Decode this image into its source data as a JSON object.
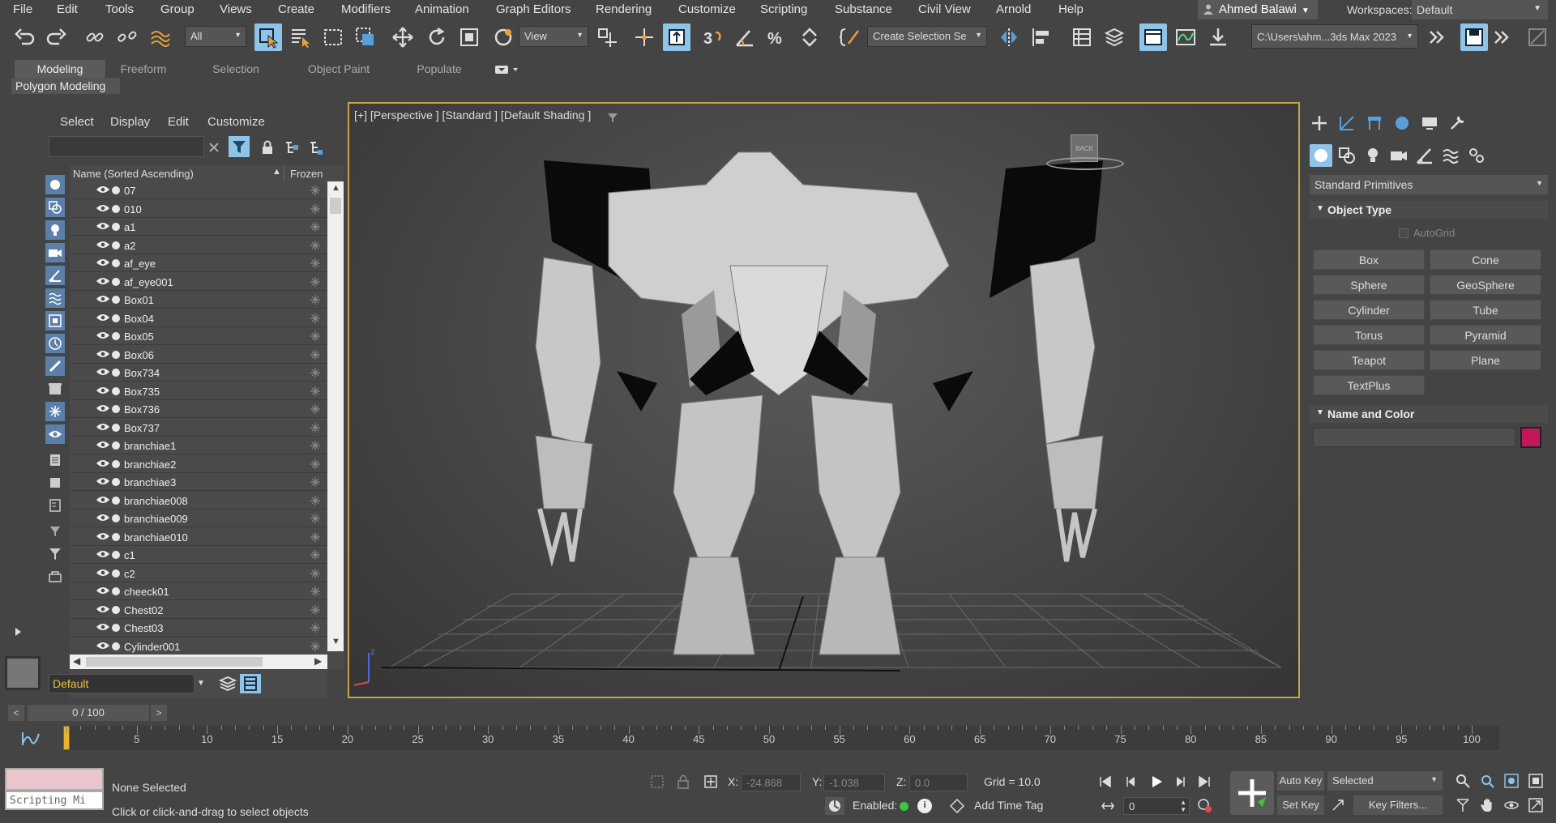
{
  "menubar": {
    "items": [
      "File",
      "Edit",
      "Tools",
      "Group",
      "Views",
      "Create",
      "Modifiers",
      "Animation",
      "Graph Editors",
      "Rendering",
      "Customize",
      "Scripting",
      "Substance",
      "Civil View",
      "Arnold",
      "Help"
    ],
    "user": "Ahmed Balawi",
    "workspaces_label": "Workspaces:",
    "workspace_value": "Default"
  },
  "toolbar": {
    "filter_value": "All",
    "view_value": "View",
    "selection_set_value": "Create Selection Se",
    "project_path": "C:\\Users\\ahm...3ds Max 2023"
  },
  "ribbon": {
    "tabs": [
      "Modeling",
      "Freeform",
      "Selection",
      "Object Paint",
      "Populate"
    ],
    "active_tab": "Modeling",
    "panel_label": "Polygon Modeling"
  },
  "scene_explorer": {
    "menus": [
      "Select",
      "Display",
      "Edit",
      "Customize"
    ],
    "column_name": "Name (Sorted Ascending)",
    "column_frozen": "Frozen",
    "items": [
      "07",
      "010",
      "a1",
      "a2",
      "af_eye",
      "af_eye001",
      "Box01",
      "Box04",
      "Box05",
      "Box06",
      "Box734",
      "Box735",
      "Box736",
      "Box737",
      "branchiae1",
      "branchiae2",
      "branchiae3",
      "branchiae008",
      "branchiae009",
      "branchiae010",
      "c1",
      "c2",
      "cheeck01",
      "Chest02",
      "Chest03",
      "Cylinder001"
    ],
    "layer_value": "Default"
  },
  "viewport": {
    "label": "[+] [Perspective ] [Standard ] [Default Shading ]",
    "viewcube_face": "BACK"
  },
  "command_panel": {
    "category": "Standard Primitives",
    "object_type_title": "Object Type",
    "autogrid_label": "AutoGrid",
    "buttons": [
      "Box",
      "Cone",
      "Sphere",
      "GeoSphere",
      "Cylinder",
      "Tube",
      "Torus",
      "Pyramid",
      "Teapot",
      "Plane",
      "TextPlus"
    ],
    "name_color_title": "Name and Color",
    "object_color": "#c2185b"
  },
  "timeline": {
    "frame_display": "0 / 100",
    "ticks": [
      "5",
      "10",
      "15",
      "20",
      "25",
      "30",
      "35",
      "40",
      "45",
      "50",
      "55",
      "60",
      "65",
      "70",
      "75",
      "80",
      "85",
      "90",
      "95",
      "100"
    ]
  },
  "status": {
    "script_label": "Scripting Mi",
    "selection": "None Selected",
    "prompt": "Click or click-and-drag to select objects",
    "x_label": "X:",
    "x_value": "-24.868",
    "y_label": "Y:",
    "y_value": "-1.038",
    "z_label": "Z:",
    "z_value": "0.0",
    "grid": "Grid = 10.0",
    "enabled_label": "Enabled:",
    "add_time_tag": "Add Time Tag",
    "auto_key": "Auto Key",
    "set_key": "Set Key",
    "key_mode_value": "Selected",
    "key_filters": "Key Filters...",
    "current_frame": "0"
  }
}
